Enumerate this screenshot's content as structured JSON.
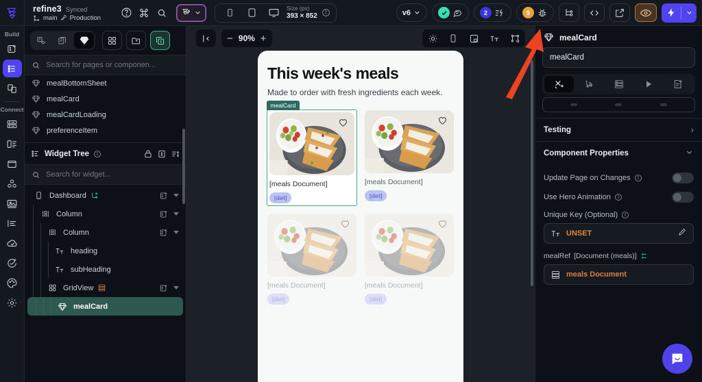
{
  "topbar": {
    "project_name": "refine3",
    "sync_status": "Synced",
    "branch": "main",
    "environment": "Production",
    "help_icon": "question-circle-icon",
    "command_icon": "command-icon",
    "search_icon": "search-icon",
    "branch_switch_icon": "branch-icon",
    "device_mobile_icon": "mobile-icon",
    "device_tablet_icon": "tablet-icon",
    "device_desktop_icon": "desktop-icon",
    "size_label": "Size (px)",
    "size_value": "393 × 852",
    "info_icon": "info-icon",
    "version_label": "v6",
    "check_icon": "check-circle-icon",
    "comment_icon": "comment-icon",
    "issues_count": "2",
    "issues_icon": "lightning-list-icon",
    "warnings_count": "9",
    "warnings_icon": "bug-icon",
    "tree_icon": "node-tree-icon",
    "code_icon": "code-brackets-icon",
    "share_icon": "external-link-icon",
    "preview_icon": "eye-icon",
    "run_icon": "lightning-bolt-icon",
    "run_caret_icon": "chevron-down-icon",
    "accent_purple": "#5243f0",
    "accent_teal": "#3ddbb0",
    "accent_orange": "#e8a33d"
  },
  "rail": {
    "build_label": "Build",
    "connect_label": "Connect",
    "items": [
      {
        "name": "page-selector-icon",
        "icon": "add-page-icon"
      },
      {
        "name": "widget-palette-icon",
        "icon": "list-bullet-icon",
        "active": true
      },
      {
        "name": "components-icon",
        "icon": "copy-pages-icon"
      },
      {
        "name": "database-icon",
        "icon": "server-icon"
      },
      {
        "name": "app-state-icon",
        "icon": "panel-list-icon"
      },
      {
        "name": "storage-icon",
        "icon": "folder-icon"
      },
      {
        "name": "api-calls-icon",
        "icon": "molecule-icon"
      },
      {
        "name": "media-icon",
        "icon": "image-icon"
      },
      {
        "name": "localization-icon",
        "icon": "align-text-icon"
      },
      {
        "name": "deploy-icon",
        "icon": "cloud-check-icon"
      },
      {
        "name": "tests-icon",
        "icon": "check-plus-icon"
      },
      {
        "name": "theme-icon",
        "icon": "palette-icon"
      },
      {
        "name": "settings-icon",
        "icon": "gear-icon"
      }
    ]
  },
  "left_panel": {
    "segments": [
      {
        "name": "tab-pages-components",
        "icon": "page-component-icon",
        "on": false
      },
      {
        "name": "tab-pages",
        "icon": "pages-icon",
        "on": false
      },
      {
        "name": "tab-components",
        "icon": "diamond-icon",
        "on": true
      }
    ],
    "actions": [
      {
        "name": "grid-view-button",
        "icon": "grid-four-icon"
      },
      {
        "name": "new-folder-button",
        "icon": "folder-plus-icon"
      },
      {
        "name": "add-component-button",
        "icon": "add-copy-icon",
        "teal": true
      }
    ],
    "search_placeholder": "Search for pages or componen...",
    "components": [
      {
        "label": "mealBottomSheet",
        "icon": "diamond-icon"
      },
      {
        "label": "mealCard",
        "icon": "diamond-icon"
      },
      {
        "label": "mealCardLoading",
        "icon": "diamond-icon"
      },
      {
        "label": "preferenceItem",
        "icon": "diamond-icon"
      }
    ],
    "widget_tree": {
      "title": "Widget Tree",
      "info_icon": "info-icon",
      "lock_icon": "lock-icon",
      "expand_icon": "expand-vertical-icon",
      "sort_icon": "sort-icon",
      "search_placeholder": "Search for widget...",
      "nodes": [
        {
          "label": "Dashboard",
          "icon": "phone-icon",
          "depth": 0,
          "has_logic": true,
          "has_actions": true,
          "selected": false
        },
        {
          "label": "Column",
          "icon": "column-icon",
          "depth": 1,
          "has_logic": false,
          "has_actions": true,
          "selected": false
        },
        {
          "label": "Column",
          "icon": "column-icon",
          "depth": 2,
          "has_logic": false,
          "has_actions": true,
          "selected": false
        },
        {
          "label": "heading",
          "icon": "text-icon",
          "depth": 3,
          "has_logic": false,
          "has_actions": false,
          "selected": false
        },
        {
          "label": "subHeading",
          "icon": "text-icon",
          "depth": 3,
          "has_logic": false,
          "has_actions": false,
          "selected": false
        },
        {
          "label": "GridView",
          "icon": "grid-icon",
          "depth": 2,
          "has_logic": false,
          "has_actions": true,
          "has_db": true,
          "selected": false
        },
        {
          "label": "mealCard",
          "icon": "diamond-icon",
          "depth": 3,
          "has_logic": false,
          "has_actions": false,
          "selected": true
        }
      ]
    }
  },
  "canvas": {
    "collapse_icon": "collapse-left-icon",
    "zoom_out": "−",
    "zoom_level": "90%",
    "zoom_in": "+",
    "tools": [
      {
        "name": "theme-toggle-icon",
        "icon": "sun-icon"
      },
      {
        "name": "device-frame-icon",
        "icon": "phone-outline-icon"
      },
      {
        "name": "responsive-icon",
        "icon": "responsive-icon"
      },
      {
        "name": "text-scale-icon",
        "icon": "text-size-icon"
      },
      {
        "name": "canvas-settings-icon",
        "icon": "node-settings-icon"
      }
    ],
    "phone": {
      "heading": "This week's meals",
      "subheading": "Made to order with fresh ingredients each week.",
      "selected_badge": "mealCard",
      "cards": [
        {
          "doc_label": "[meals Document]",
          "diet_label": "[diet]",
          "selected": true,
          "faded": false
        },
        {
          "doc_label": "[meals Document]",
          "diet_label": "[diet]",
          "selected": false,
          "faded": false
        },
        {
          "doc_label": "[meals Document]",
          "diet_label": "[diet]",
          "selected": false,
          "faded": true
        },
        {
          "doc_label": "[meals Document]",
          "diet_label": "[diet]",
          "selected": false,
          "faded": true
        }
      ]
    }
  },
  "right_panel": {
    "title": "mealCard",
    "title_icon": "diamond-icon",
    "name_value": "mealCard",
    "tabs": [
      {
        "name": "tab-properties",
        "icon": "tools-icon",
        "on": true
      },
      {
        "name": "tab-actions",
        "icon": "cursor-flow-icon",
        "on": false
      },
      {
        "name": "tab-backend-query",
        "icon": "server-icon",
        "on": false
      },
      {
        "name": "tab-animations",
        "icon": "play-icon",
        "on": false
      },
      {
        "name": "tab-generate",
        "icon": "doc-plus-icon",
        "on": false
      }
    ],
    "testing_label": "Testing",
    "component_properties_label": "Component Properties",
    "collapse_icon": "chevron-down-icon",
    "props": [
      {
        "label": "Update Page on Changes",
        "info": "info-icon",
        "toggle": false
      },
      {
        "label": "Use Hero Animation",
        "info": "info-icon",
        "toggle": false
      }
    ],
    "unique_key_label": "Unique Key (Optional)",
    "unique_key_value": "UNSET",
    "unique_key_icon": "text-format-icon",
    "edit_icon": "pencil-icon",
    "meal_ref_label": "mealRef",
    "meal_ref_type": "[Document (meals)]",
    "meal_ref_value": "meals Document",
    "meal_ref_icon": "server-icon",
    "orange": "#e0843c"
  },
  "overlay": {
    "arrow_color": "#ee4322",
    "intercom_icon": "chat-bubble-icon"
  }
}
